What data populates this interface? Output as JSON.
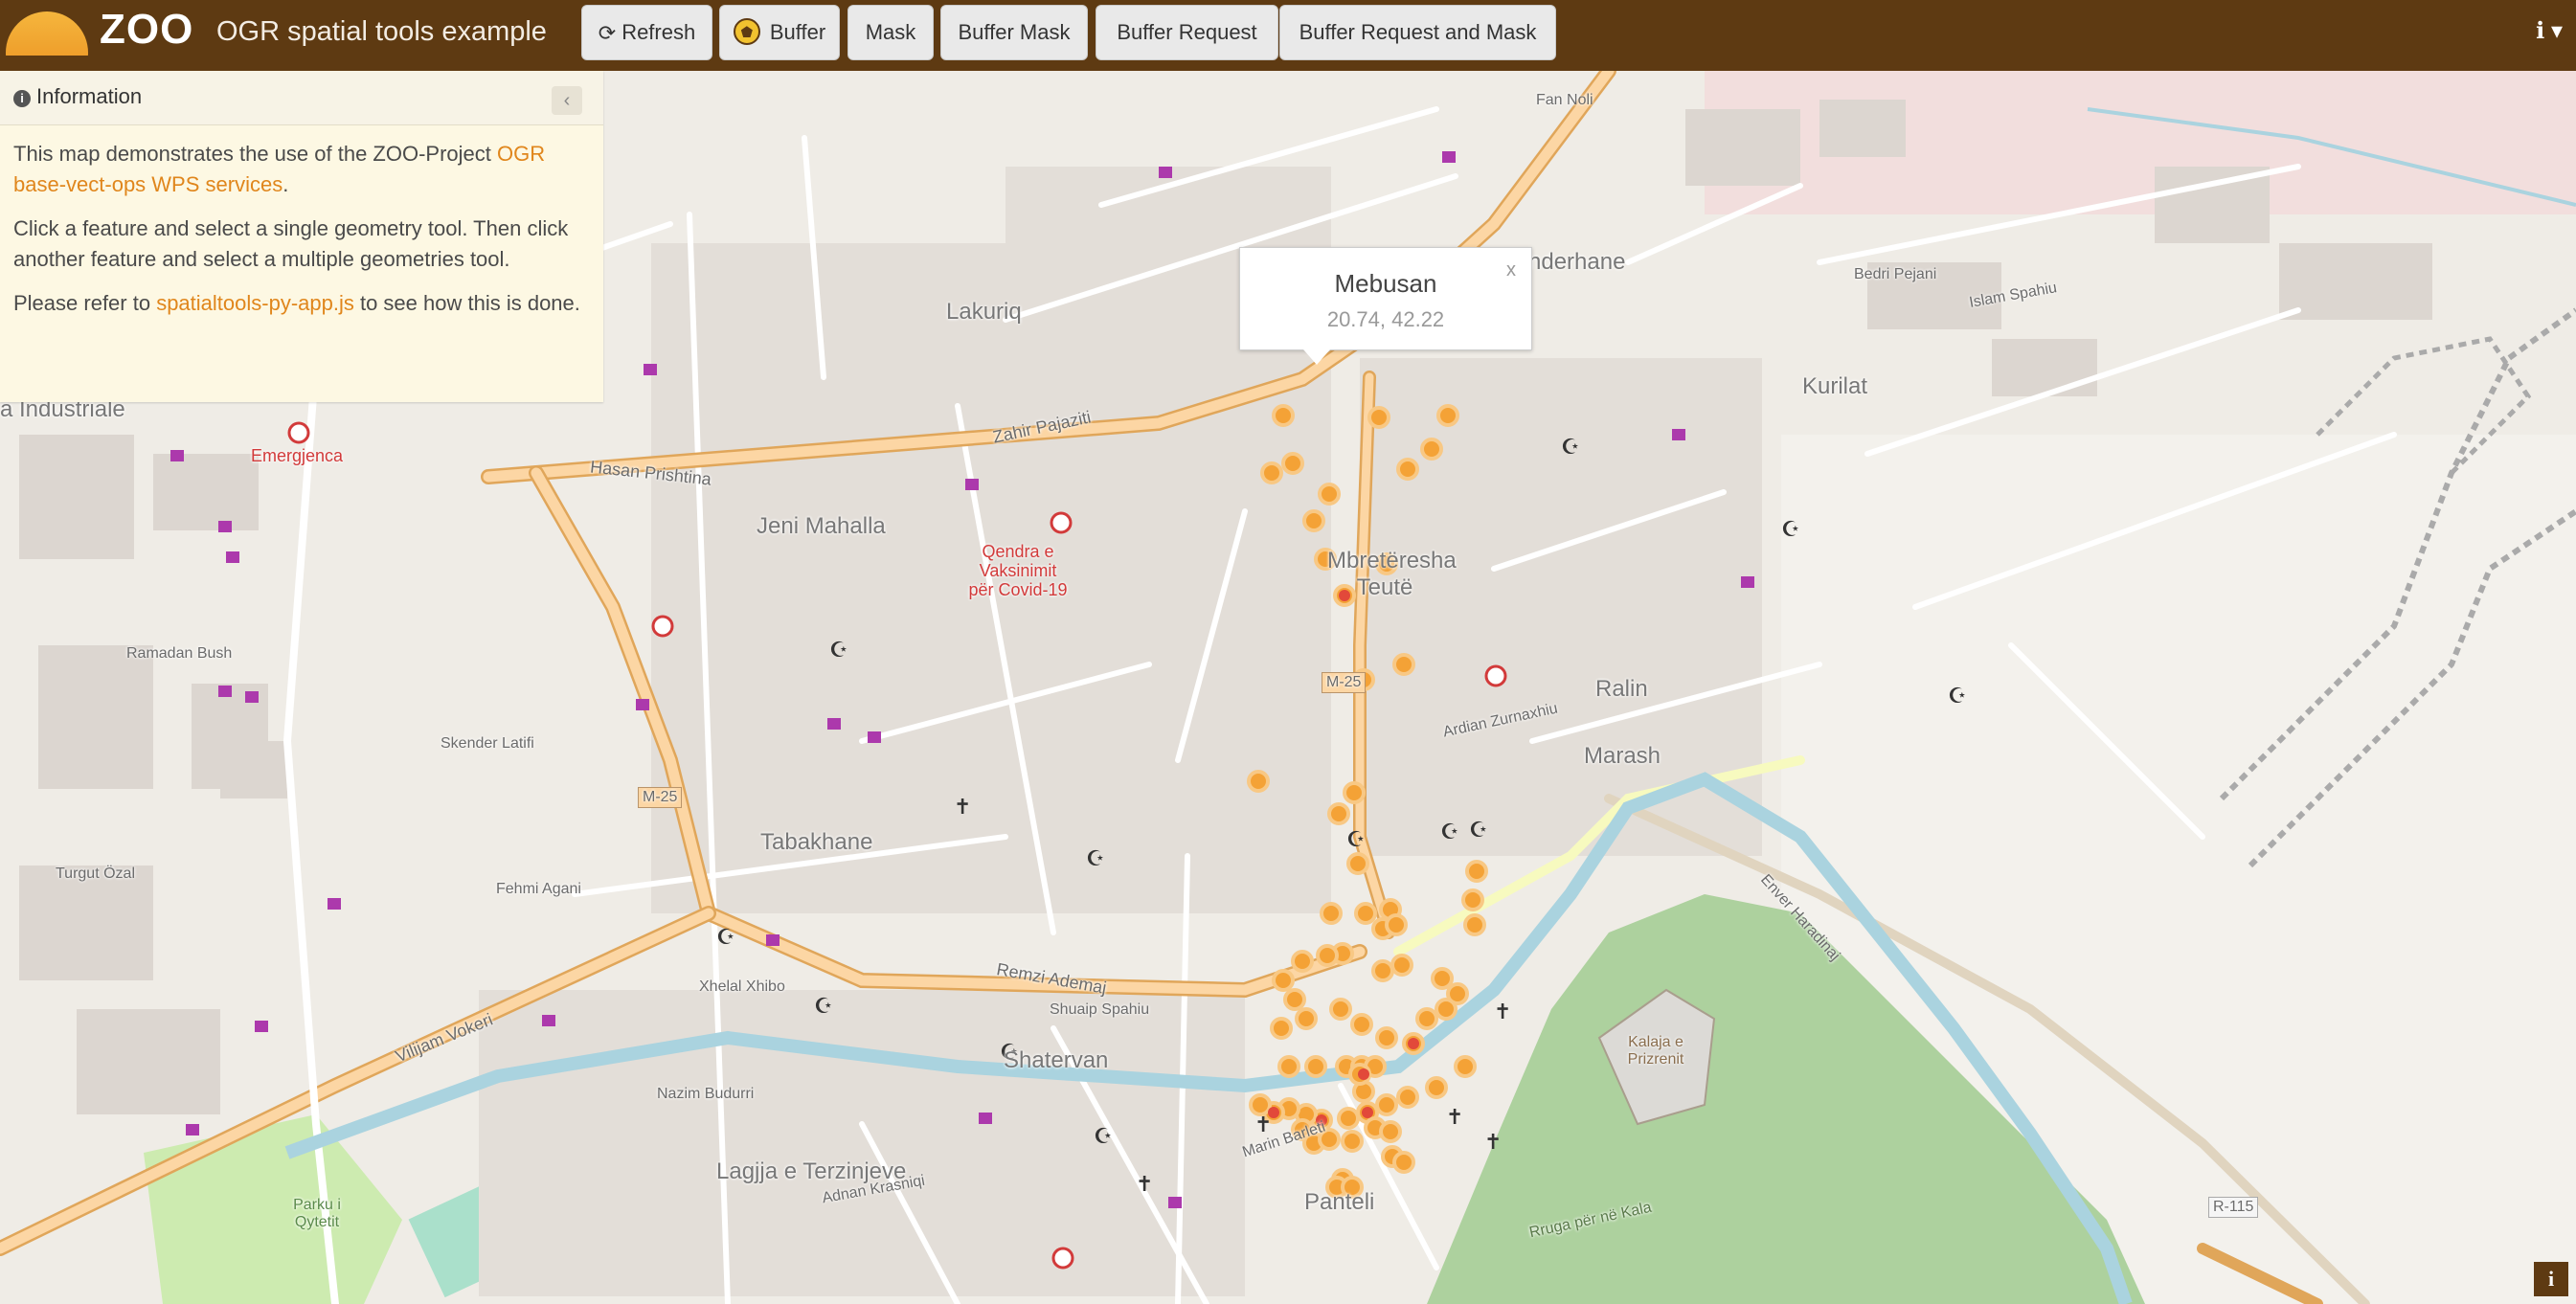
{
  "header": {
    "logo_text": "ZOO",
    "app_title": "OGR spatial tools example",
    "buttons": {
      "refresh": "Refresh",
      "buffer": "Buffer",
      "mask": "Mask",
      "buffer_mask": "Buffer Mask",
      "buffer_request": "Buffer Request",
      "buffer_request_mask": "Buffer Request and Mask"
    },
    "info_menu_icon": "info-icon"
  },
  "sidebar": {
    "title": "Information",
    "p1_pre": "This map demonstrates the use of the ZOO-Project ",
    "p1_link": "OGR base-vect-ops WPS services",
    "p1_post": ".",
    "p2": "Click a feature and select a single geometry tool. Then click another feature and select a multiple geometries tool.",
    "p3_pre": "Please refer to ",
    "p3_link": "spatialtools-py-app.js",
    "p3_post": " to see how this is done."
  },
  "popup": {
    "title": "Mebusan",
    "coords": "20.74, 42.22",
    "close": "x"
  },
  "map_labels": {
    "lakuriq": "Lakuriq",
    "jeni_mahalla": "Jeni Mahalla",
    "tabakhane": "Tabakhane",
    "shatervan": "Shatervan",
    "panteli": "Panteli",
    "lagjja": "Lagjja e Terzinjeve",
    "marash": "Marash",
    "ralin": "Ralin",
    "kurilat": "Kurilat",
    "mbreteresha": "Mbretëresha Teutë",
    "industriale": "a Industriale",
    "emergjenca": "Emergjenca",
    "qendra": "Qendra e Vaksinimit për Covid-19",
    "kalaja": "Kalaja e Prizrenit",
    "m25_a": "M-25",
    "m25_b": "M-25",
    "r115": "R-115",
    "hasan_prishtina": "Hasan Prishtina",
    "zahir_pajaziti": "Zahir Pajaziti",
    "remzi_ademaj": "Remzi Ademaj",
    "vilijam_vokeri": "Vilijam Vokeri",
    "parku": "Parku i Qytetit",
    "enderhane": "nderhane",
    "ramadan_bush": "Ramadan Bush",
    "skender_latifi": "Skender Latifi",
    "fehmi_agani": "Fehmi Agani",
    "turgut_ozal": "Turgut Özal",
    "nazim_budurri": "Nazim Budurri",
    "adnan_krasniqi": "Adnan Krasniqi",
    "marin_barleti": "Marin Barleti",
    "ardian_zurnaxhiu": "Ardian Zurnaxhiu",
    "enver_haradinaj": "Enver Haradinaj",
    "shuaip_spahiu": "Shuaip Spahiu",
    "xhelal_xhibo": "Xhelal Xhibo",
    "rruga_kala": "Rruga për në Kala",
    "fan_noli": "Fan Noli",
    "bedri_pejani": "Bedri Pejani",
    "islam_spahiu": "Islam Spahiu"
  },
  "colors": {
    "navbar": "#5e3a12",
    "accent": "#e0861c",
    "feature_fill": "#f4a236",
    "feature_core": "#e2493a"
  }
}
